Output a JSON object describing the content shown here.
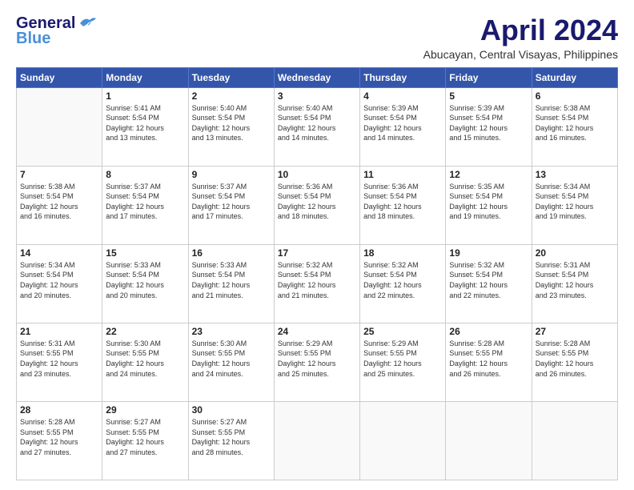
{
  "header": {
    "logo_line1": "General",
    "logo_line2": "Blue",
    "month": "April 2024",
    "location": "Abucayan, Central Visayas, Philippines"
  },
  "days_of_week": [
    "Sunday",
    "Monday",
    "Tuesday",
    "Wednesday",
    "Thursday",
    "Friday",
    "Saturday"
  ],
  "weeks": [
    [
      {
        "day": "",
        "info": ""
      },
      {
        "day": "1",
        "info": "Sunrise: 5:41 AM\nSunset: 5:54 PM\nDaylight: 12 hours\nand 13 minutes."
      },
      {
        "day": "2",
        "info": "Sunrise: 5:40 AM\nSunset: 5:54 PM\nDaylight: 12 hours\nand 13 minutes."
      },
      {
        "day": "3",
        "info": "Sunrise: 5:40 AM\nSunset: 5:54 PM\nDaylight: 12 hours\nand 14 minutes."
      },
      {
        "day": "4",
        "info": "Sunrise: 5:39 AM\nSunset: 5:54 PM\nDaylight: 12 hours\nand 14 minutes."
      },
      {
        "day": "5",
        "info": "Sunrise: 5:39 AM\nSunset: 5:54 PM\nDaylight: 12 hours\nand 15 minutes."
      },
      {
        "day": "6",
        "info": "Sunrise: 5:38 AM\nSunset: 5:54 PM\nDaylight: 12 hours\nand 16 minutes."
      }
    ],
    [
      {
        "day": "7",
        "info": "Sunrise: 5:38 AM\nSunset: 5:54 PM\nDaylight: 12 hours\nand 16 minutes."
      },
      {
        "day": "8",
        "info": "Sunrise: 5:37 AM\nSunset: 5:54 PM\nDaylight: 12 hours\nand 17 minutes."
      },
      {
        "day": "9",
        "info": "Sunrise: 5:37 AM\nSunset: 5:54 PM\nDaylight: 12 hours\nand 17 minutes."
      },
      {
        "day": "10",
        "info": "Sunrise: 5:36 AM\nSunset: 5:54 PM\nDaylight: 12 hours\nand 18 minutes."
      },
      {
        "day": "11",
        "info": "Sunrise: 5:36 AM\nSunset: 5:54 PM\nDaylight: 12 hours\nand 18 minutes."
      },
      {
        "day": "12",
        "info": "Sunrise: 5:35 AM\nSunset: 5:54 PM\nDaylight: 12 hours\nand 19 minutes."
      },
      {
        "day": "13",
        "info": "Sunrise: 5:34 AM\nSunset: 5:54 PM\nDaylight: 12 hours\nand 19 minutes."
      }
    ],
    [
      {
        "day": "14",
        "info": "Sunrise: 5:34 AM\nSunset: 5:54 PM\nDaylight: 12 hours\nand 20 minutes."
      },
      {
        "day": "15",
        "info": "Sunrise: 5:33 AM\nSunset: 5:54 PM\nDaylight: 12 hours\nand 20 minutes."
      },
      {
        "day": "16",
        "info": "Sunrise: 5:33 AM\nSunset: 5:54 PM\nDaylight: 12 hours\nand 21 minutes."
      },
      {
        "day": "17",
        "info": "Sunrise: 5:32 AM\nSunset: 5:54 PM\nDaylight: 12 hours\nand 21 minutes."
      },
      {
        "day": "18",
        "info": "Sunrise: 5:32 AM\nSunset: 5:54 PM\nDaylight: 12 hours\nand 22 minutes."
      },
      {
        "day": "19",
        "info": "Sunrise: 5:32 AM\nSunset: 5:54 PM\nDaylight: 12 hours\nand 22 minutes."
      },
      {
        "day": "20",
        "info": "Sunrise: 5:31 AM\nSunset: 5:54 PM\nDaylight: 12 hours\nand 23 minutes."
      }
    ],
    [
      {
        "day": "21",
        "info": "Sunrise: 5:31 AM\nSunset: 5:55 PM\nDaylight: 12 hours\nand 23 minutes."
      },
      {
        "day": "22",
        "info": "Sunrise: 5:30 AM\nSunset: 5:55 PM\nDaylight: 12 hours\nand 24 minutes."
      },
      {
        "day": "23",
        "info": "Sunrise: 5:30 AM\nSunset: 5:55 PM\nDaylight: 12 hours\nand 24 minutes."
      },
      {
        "day": "24",
        "info": "Sunrise: 5:29 AM\nSunset: 5:55 PM\nDaylight: 12 hours\nand 25 minutes."
      },
      {
        "day": "25",
        "info": "Sunrise: 5:29 AM\nSunset: 5:55 PM\nDaylight: 12 hours\nand 25 minutes."
      },
      {
        "day": "26",
        "info": "Sunrise: 5:28 AM\nSunset: 5:55 PM\nDaylight: 12 hours\nand 26 minutes."
      },
      {
        "day": "27",
        "info": "Sunrise: 5:28 AM\nSunset: 5:55 PM\nDaylight: 12 hours\nand 26 minutes."
      }
    ],
    [
      {
        "day": "28",
        "info": "Sunrise: 5:28 AM\nSunset: 5:55 PM\nDaylight: 12 hours\nand 27 minutes."
      },
      {
        "day": "29",
        "info": "Sunrise: 5:27 AM\nSunset: 5:55 PM\nDaylight: 12 hours\nand 27 minutes."
      },
      {
        "day": "30",
        "info": "Sunrise: 5:27 AM\nSunset: 5:55 PM\nDaylight: 12 hours\nand 28 minutes."
      },
      {
        "day": "",
        "info": ""
      },
      {
        "day": "",
        "info": ""
      },
      {
        "day": "",
        "info": ""
      },
      {
        "day": "",
        "info": ""
      }
    ]
  ]
}
